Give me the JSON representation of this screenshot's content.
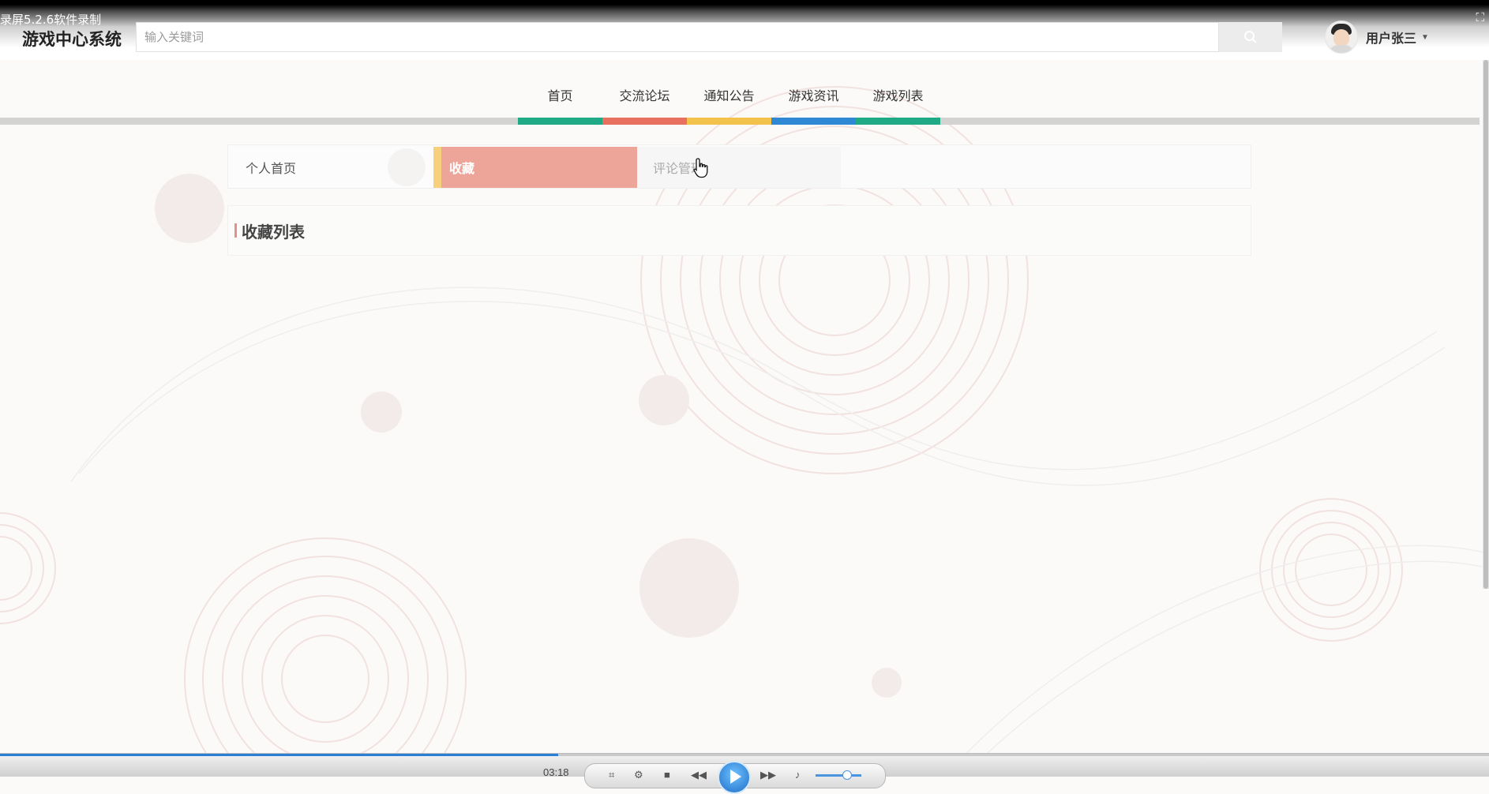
{
  "overlay": {
    "recorder_label": "录屏5.2.6软件录制"
  },
  "header": {
    "logo": "游戏中心系统",
    "search": {
      "placeholder": "输入关键词",
      "value": ""
    },
    "user": {
      "name": "用户张三"
    }
  },
  "nav": {
    "items": [
      {
        "label": "首页",
        "color": "#1fa985"
      },
      {
        "label": "交流论坛",
        "color": "#e8705e"
      },
      {
        "label": "通知公告",
        "color": "#f2c24c"
      },
      {
        "label": "游戏资讯",
        "color": "#2e88d4"
      },
      {
        "label": "游戏列表",
        "color": "#1fa985"
      }
    ]
  },
  "tabs": {
    "home": "个人首页",
    "favorites": "收藏",
    "comments": "评论管理"
  },
  "content": {
    "title": "收藏列表"
  },
  "player": {
    "time": "03:18",
    "progress": 0.375
  },
  "colors": {
    "accent": "#eea599",
    "tab_marker": "#f6d07a",
    "title_accent": "#e0918a",
    "background": "#fbfaf9"
  }
}
